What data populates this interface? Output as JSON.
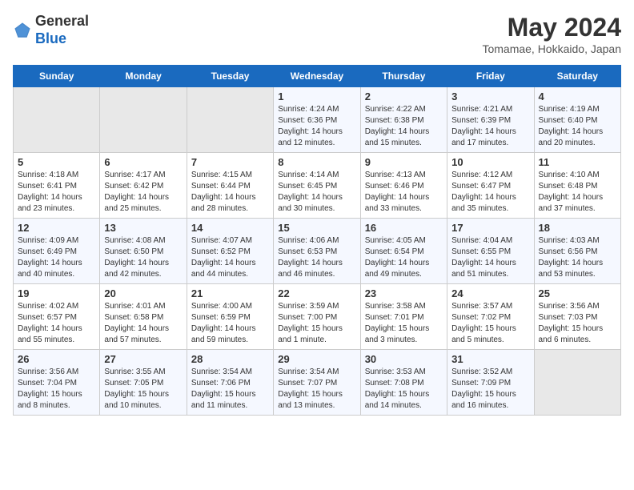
{
  "header": {
    "logo_general": "General",
    "logo_blue": "Blue",
    "month_title": "May 2024",
    "location": "Tomamae, Hokkaido, Japan"
  },
  "days_of_week": [
    "Sunday",
    "Monday",
    "Tuesday",
    "Wednesday",
    "Thursday",
    "Friday",
    "Saturday"
  ],
  "weeks": [
    [
      {
        "day": "",
        "info": ""
      },
      {
        "day": "",
        "info": ""
      },
      {
        "day": "",
        "info": ""
      },
      {
        "day": "1",
        "info": "Sunrise: 4:24 AM\nSunset: 6:36 PM\nDaylight: 14 hours\nand 12 minutes."
      },
      {
        "day": "2",
        "info": "Sunrise: 4:22 AM\nSunset: 6:38 PM\nDaylight: 14 hours\nand 15 minutes."
      },
      {
        "day": "3",
        "info": "Sunrise: 4:21 AM\nSunset: 6:39 PM\nDaylight: 14 hours\nand 17 minutes."
      },
      {
        "day": "4",
        "info": "Sunrise: 4:19 AM\nSunset: 6:40 PM\nDaylight: 14 hours\nand 20 minutes."
      }
    ],
    [
      {
        "day": "5",
        "info": "Sunrise: 4:18 AM\nSunset: 6:41 PM\nDaylight: 14 hours\nand 23 minutes."
      },
      {
        "day": "6",
        "info": "Sunrise: 4:17 AM\nSunset: 6:42 PM\nDaylight: 14 hours\nand 25 minutes."
      },
      {
        "day": "7",
        "info": "Sunrise: 4:15 AM\nSunset: 6:44 PM\nDaylight: 14 hours\nand 28 minutes."
      },
      {
        "day": "8",
        "info": "Sunrise: 4:14 AM\nSunset: 6:45 PM\nDaylight: 14 hours\nand 30 minutes."
      },
      {
        "day": "9",
        "info": "Sunrise: 4:13 AM\nSunset: 6:46 PM\nDaylight: 14 hours\nand 33 minutes."
      },
      {
        "day": "10",
        "info": "Sunrise: 4:12 AM\nSunset: 6:47 PM\nDaylight: 14 hours\nand 35 minutes."
      },
      {
        "day": "11",
        "info": "Sunrise: 4:10 AM\nSunset: 6:48 PM\nDaylight: 14 hours\nand 37 minutes."
      }
    ],
    [
      {
        "day": "12",
        "info": "Sunrise: 4:09 AM\nSunset: 6:49 PM\nDaylight: 14 hours\nand 40 minutes."
      },
      {
        "day": "13",
        "info": "Sunrise: 4:08 AM\nSunset: 6:50 PM\nDaylight: 14 hours\nand 42 minutes."
      },
      {
        "day": "14",
        "info": "Sunrise: 4:07 AM\nSunset: 6:52 PM\nDaylight: 14 hours\nand 44 minutes."
      },
      {
        "day": "15",
        "info": "Sunrise: 4:06 AM\nSunset: 6:53 PM\nDaylight: 14 hours\nand 46 minutes."
      },
      {
        "day": "16",
        "info": "Sunrise: 4:05 AM\nSunset: 6:54 PM\nDaylight: 14 hours\nand 49 minutes."
      },
      {
        "day": "17",
        "info": "Sunrise: 4:04 AM\nSunset: 6:55 PM\nDaylight: 14 hours\nand 51 minutes."
      },
      {
        "day": "18",
        "info": "Sunrise: 4:03 AM\nSunset: 6:56 PM\nDaylight: 14 hours\nand 53 minutes."
      }
    ],
    [
      {
        "day": "19",
        "info": "Sunrise: 4:02 AM\nSunset: 6:57 PM\nDaylight: 14 hours\nand 55 minutes."
      },
      {
        "day": "20",
        "info": "Sunrise: 4:01 AM\nSunset: 6:58 PM\nDaylight: 14 hours\nand 57 minutes."
      },
      {
        "day": "21",
        "info": "Sunrise: 4:00 AM\nSunset: 6:59 PM\nDaylight: 14 hours\nand 59 minutes."
      },
      {
        "day": "22",
        "info": "Sunrise: 3:59 AM\nSunset: 7:00 PM\nDaylight: 15 hours\nand 1 minute."
      },
      {
        "day": "23",
        "info": "Sunrise: 3:58 AM\nSunset: 7:01 PM\nDaylight: 15 hours\nand 3 minutes."
      },
      {
        "day": "24",
        "info": "Sunrise: 3:57 AM\nSunset: 7:02 PM\nDaylight: 15 hours\nand 5 minutes."
      },
      {
        "day": "25",
        "info": "Sunrise: 3:56 AM\nSunset: 7:03 PM\nDaylight: 15 hours\nand 6 minutes."
      }
    ],
    [
      {
        "day": "26",
        "info": "Sunrise: 3:56 AM\nSunset: 7:04 PM\nDaylight: 15 hours\nand 8 minutes."
      },
      {
        "day": "27",
        "info": "Sunrise: 3:55 AM\nSunset: 7:05 PM\nDaylight: 15 hours\nand 10 minutes."
      },
      {
        "day": "28",
        "info": "Sunrise: 3:54 AM\nSunset: 7:06 PM\nDaylight: 15 hours\nand 11 minutes."
      },
      {
        "day": "29",
        "info": "Sunrise: 3:54 AM\nSunset: 7:07 PM\nDaylight: 15 hours\nand 13 minutes."
      },
      {
        "day": "30",
        "info": "Sunrise: 3:53 AM\nSunset: 7:08 PM\nDaylight: 15 hours\nand 14 minutes."
      },
      {
        "day": "31",
        "info": "Sunrise: 3:52 AM\nSunset: 7:09 PM\nDaylight: 15 hours\nand 16 minutes."
      },
      {
        "day": "",
        "info": ""
      }
    ]
  ]
}
